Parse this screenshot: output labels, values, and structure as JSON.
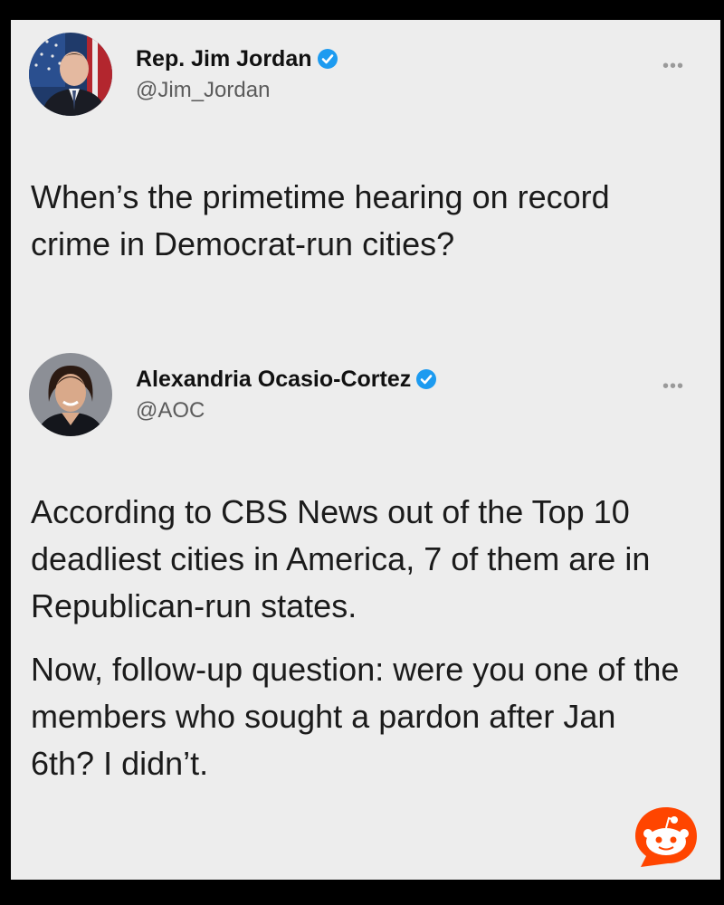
{
  "tweets": [
    {
      "display_name": "Rep. Jim Jordan",
      "handle": "@Jim_Jordan",
      "more_icon": "more-options-icon",
      "paragraphs": [
        "When’s the primetime hearing on record crime in Democrat-run cities?"
      ]
    },
    {
      "display_name": "Alexandria Ocasio-Cortez",
      "handle": "@AOC",
      "more_icon": "more-options-icon",
      "paragraphs": [
        "According to CBS News out of the Top 10 deadliest cities in America, 7 of them are in Republican-run states.",
        "Now, follow-up question: were you one of the members who sought a pardon after Jan 6th? I didn’t."
      ]
    }
  ],
  "colors": {
    "verified": "#1d9bf0",
    "reddit": "#ff4500",
    "background": "#ededed"
  },
  "watermark_icon": "reddit-logo-icon"
}
